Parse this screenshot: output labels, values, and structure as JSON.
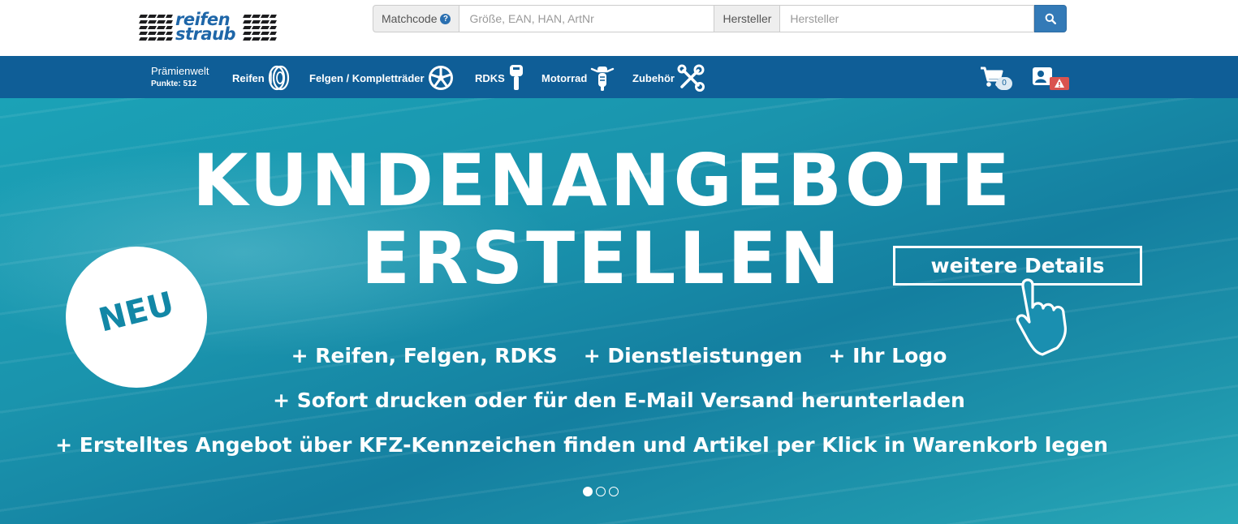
{
  "logo": {
    "line1": "reifen",
    "line2": "straub"
  },
  "search": {
    "matchcode_label": "Matchcode",
    "matchcode_help": "?",
    "matchcode_placeholder": "Größe, EAN, HAN, ArtNr",
    "manufacturer_label": "Hersteller",
    "manufacturer_placeholder": "Hersteller"
  },
  "nav": {
    "praemienwelt": "Prämienwelt",
    "punkte": "Punkte: 512",
    "items": [
      {
        "label": "Reifen",
        "icon": "tire-icon"
      },
      {
        "label": "Felgen / Kompletträder",
        "icon": "rim-icon"
      },
      {
        "label": "RDKS",
        "icon": "valve-sensor-icon"
      },
      {
        "label": "Motorrad",
        "icon": "motorcycle-icon"
      },
      {
        "label": "Zubehör",
        "icon": "tools-icon"
      }
    ],
    "cart_count": "0"
  },
  "hero": {
    "title_line1": "KUNDENANGEBOTE",
    "title_line2": "ERSTELLEN",
    "badge": "NEU",
    "details_button": "weitere Details",
    "bullets_row1": [
      "+ Reifen, Felgen, RDKS",
      "+ Dienstleistungen",
      "+ Ihr Logo"
    ],
    "bullet2": "+ Sofort drucken oder für den E-Mail Versand herunterladen",
    "bullet3": "+ Erstelltes Angebot über KFZ-Kennzeichen finden und Artikel per Klick in Warenkorb legen",
    "slides": 3,
    "active_slide": 1
  },
  "colors": {
    "nav_bg": "#0f5e97",
    "brand_blue": "#1e66a8",
    "hero_teal": "#1a94ad",
    "button_blue": "#337ab7",
    "warning_red": "#d9534f"
  }
}
